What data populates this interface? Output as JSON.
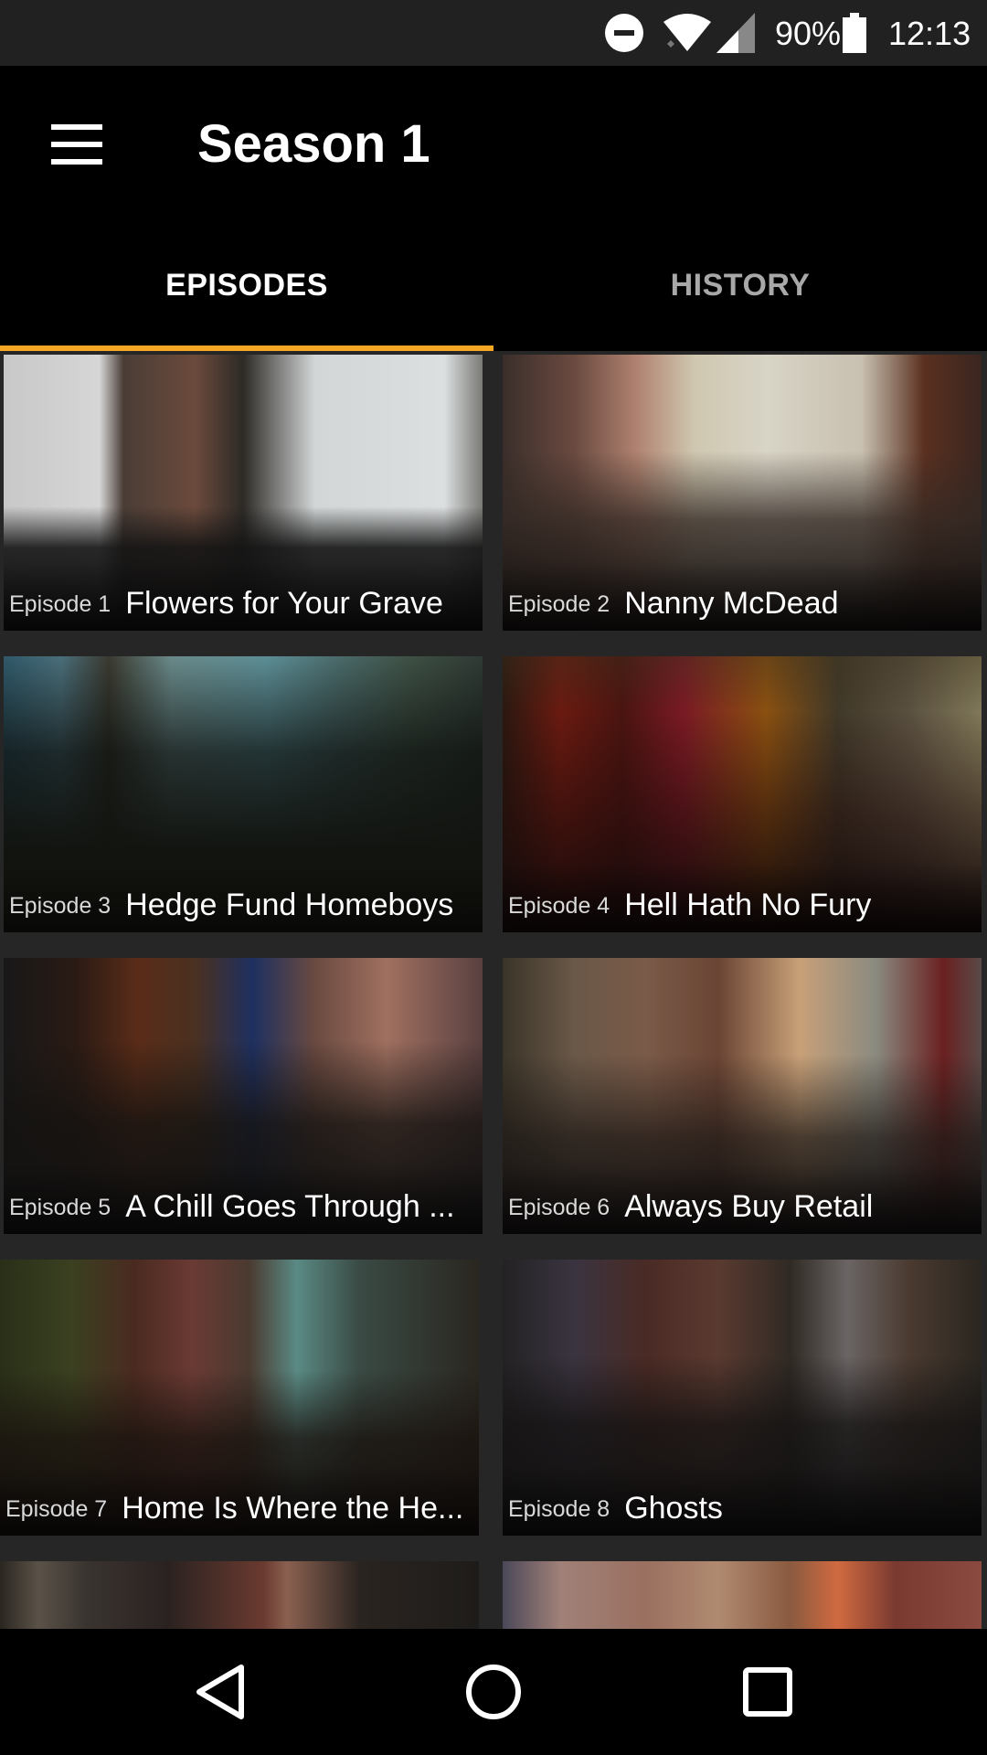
{
  "status_bar": {
    "battery": "90%",
    "time": "12:13",
    "icons": [
      "do-not-disturb-icon",
      "wifi-icon",
      "cell-signal-icon",
      "battery-icon"
    ]
  },
  "app_bar": {
    "title": "Season 1",
    "menu_icon": "hamburger-menu-icon"
  },
  "tabs": [
    {
      "label": "EPISODES",
      "active": true
    },
    {
      "label": "HISTORY",
      "active": false
    }
  ],
  "colors": {
    "accent": "#f5a623",
    "background": "#000000",
    "grid_background": "#262626"
  },
  "episodes": [
    {
      "number": "Episode 1",
      "title": "Flowers for Your Grave"
    },
    {
      "number": "Episode 2",
      "title": "Nanny McDead"
    },
    {
      "number": "Episode 3",
      "title": "Hedge Fund Homeboys"
    },
    {
      "number": "Episode 4",
      "title": "Hell Hath No Fury"
    },
    {
      "number": "Episode 5",
      "title": "A Chill Goes Through ..."
    },
    {
      "number": "Episode 6",
      "title": "Always Buy Retail"
    },
    {
      "number": "Episode 7",
      "title": "Home Is Where the He..."
    },
    {
      "number": "Episode 8",
      "title": "Ghosts"
    }
  ],
  "nav_bar": {
    "icons": [
      "back-icon",
      "home-icon",
      "recents-icon"
    ]
  }
}
